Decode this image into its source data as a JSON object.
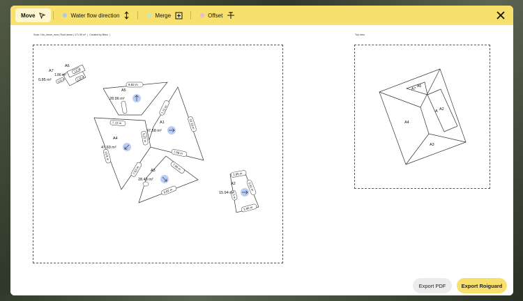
{
  "toolbar": {
    "move": "Move",
    "water": "Water flow direction",
    "merge": "Merge",
    "offset": "Offset"
  },
  "colors": {
    "accent": "#f7e06b",
    "water_dot": "#a9c8f5",
    "merge_dot": "#bfe7d6",
    "offset_dot": "#e8b8e0",
    "arrow_circle": "#b9cdf6"
  },
  "main": {
    "caption_scan": "Scan: Urs_drone_new | Roof areas | 171.59 m²",
    "caption_created": "Created by Bitoo",
    "faces": {
      "a6": {
        "name": "A6",
        "area": ""
      },
      "a7": {
        "name": "A7",
        "area": "0.85 m²"
      },
      "a7b": {
        "area": "1.86 m²"
      },
      "a5": {
        "name": "A5",
        "area": "28.96 m²",
        "edge1": "9.82 m",
        "edge2": "5.95 m"
      },
      "a1": {
        "name": "A1",
        "area": "47.58 m²",
        "edge1": "7.71 m",
        "edge2": "10.19 m",
        "edge3": "7.68 m"
      },
      "a4": {
        "name": "A4",
        "area": "47.69 m²",
        "edge1": "7.72 m",
        "edge2": "5.22 m",
        "edge3": "10.8 m",
        "edge4": "7.63 m"
      },
      "a3": {
        "name": "A3",
        "area": "28.48 m²",
        "edge1": "7.68 m",
        "edge2": "9.82 m"
      },
      "a2": {
        "name": "A2",
        "area": "15.94 m²",
        "edge1": "2.85 m",
        "edge2": "5.41 m",
        "edge3": "2.86 m",
        "edge4": "1.5 m"
      },
      "small": {
        "e1": "1.0 m",
        "e2": "0.41 m",
        "e3": "1.35 m",
        "e4": "1.35 m"
      }
    }
  },
  "topview": {
    "caption": "Top view",
    "labels": {
      "a6": "A6",
      "a7": "A7",
      "a2": "A2",
      "a": "A",
      "a4": "A4",
      "a3": "A3"
    }
  },
  "footer": {
    "export_pdf": "Export PDF",
    "export_roiguard": "Export Roiguard"
  }
}
